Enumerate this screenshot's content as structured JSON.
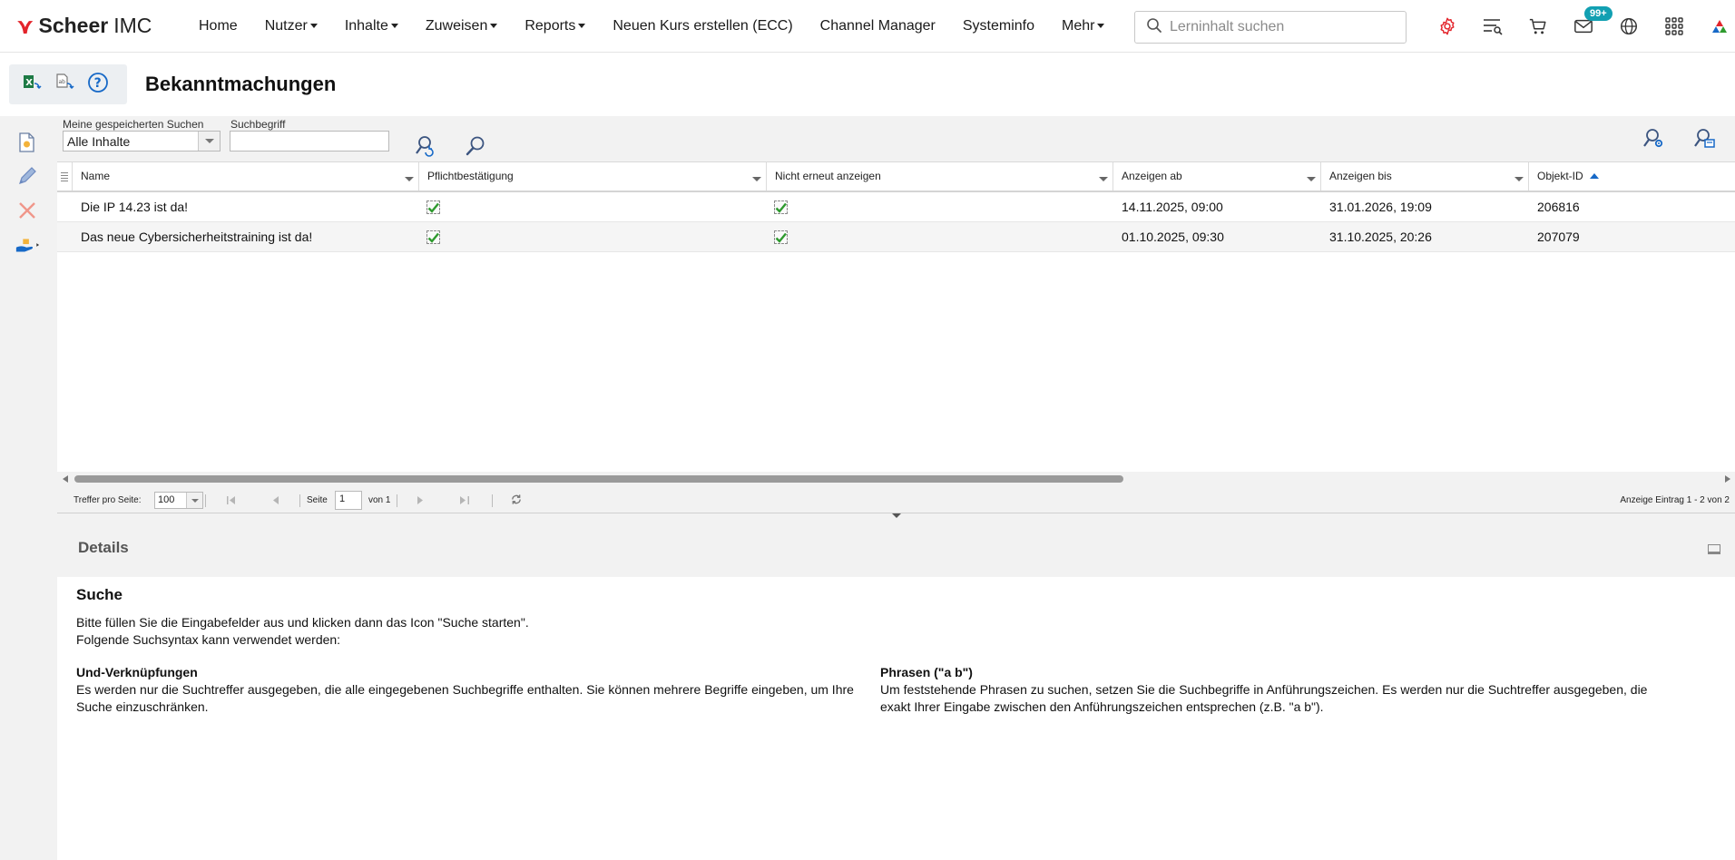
{
  "app": {
    "brand_bold": "Scheer",
    "brand_light": "IMC"
  },
  "nav": {
    "items": [
      {
        "label": "Home",
        "caret": false
      },
      {
        "label": "Nutzer",
        "caret": true
      },
      {
        "label": "Inhalte",
        "caret": true
      },
      {
        "label": "Zuweisen",
        "caret": true
      },
      {
        "label": "Reports",
        "caret": true
      },
      {
        "label": "Neuen Kurs erstellen (ECC)",
        "caret": false
      },
      {
        "label": "Channel Manager",
        "caret": false
      },
      {
        "label": "Systeminfo",
        "caret": false
      },
      {
        "label": "Mehr",
        "caret": true
      }
    ],
    "search_placeholder": "Lerninhalt suchen",
    "mail_badge": "99+",
    "icons": [
      "settings-gear-icon",
      "learning-list-icon",
      "cart-icon",
      "mail-icon",
      "globe-icon",
      "apps-grid-icon",
      "brand-app-icon"
    ]
  },
  "page": {
    "title": "Bekanntmachungen"
  },
  "search": {
    "saved_label": "Meine gespeicherten Suchen",
    "saved_value": "Alle Inhalte",
    "term_label": "Suchbegriff",
    "term_value": ""
  },
  "grid": {
    "columns": [
      "Name",
      "Pflichtbestätigung",
      "Nicht erneut anzeigen",
      "Anzeigen ab",
      "Anzeigen bis",
      "Objekt-ID"
    ],
    "rows": [
      {
        "name": "Die IP 14.23 ist da!",
        "pflicht": true,
        "nicht_erneut": true,
        "ab": "14.11.2025, 09:00",
        "bis": "31.01.2026, 19:09",
        "id": "206816"
      },
      {
        "name": "Das neue Cybersicherheitstraining ist da!",
        "pflicht": true,
        "nicht_erneut": true,
        "ab": "01.10.2025, 09:30",
        "bis": "31.10.2025, 20:26",
        "id": "207079"
      }
    ]
  },
  "pager": {
    "per_page_label": "Treffer pro Seite:",
    "per_page_value": "100",
    "page_label": "Seite",
    "page_value": "1",
    "of_label": "von 1",
    "summary": "Anzeige Eintrag 1 - 2 von 2"
  },
  "details": {
    "title": "Details",
    "heading": "Suche",
    "line1": "Bitte füllen Sie die Eingabefelder aus und klicken dann das Icon \"Suche starten\".",
    "line2": "Folgende Suchsyntax kann verwendet werden:",
    "and_title": "Und-Verknüpfungen",
    "and_text": "Es werden nur die Suchtreffer ausgegeben, die alle eingegebenen Suchbegriffe enthalten. Sie können mehrere Begriffe eingeben, um Ihre Suche einzuschränken.",
    "phrase_title": "Phrasen (\"a b\")",
    "phrase_text": "Um feststehende Phrasen zu suchen, setzen Sie die Suchbegriffe in Anführungszeichen. Es werden nur die Suchtreffer ausgegeben, die exakt Ihrer Eingabe zwischen den Anführungszeichen entsprechen (z.B. \"a b\")."
  },
  "colors": {
    "brand_red": "#e3242b",
    "badge_teal": "#12a0b2",
    "sort_blue": "#1769c7",
    "check_green": "#2e9a2e"
  }
}
